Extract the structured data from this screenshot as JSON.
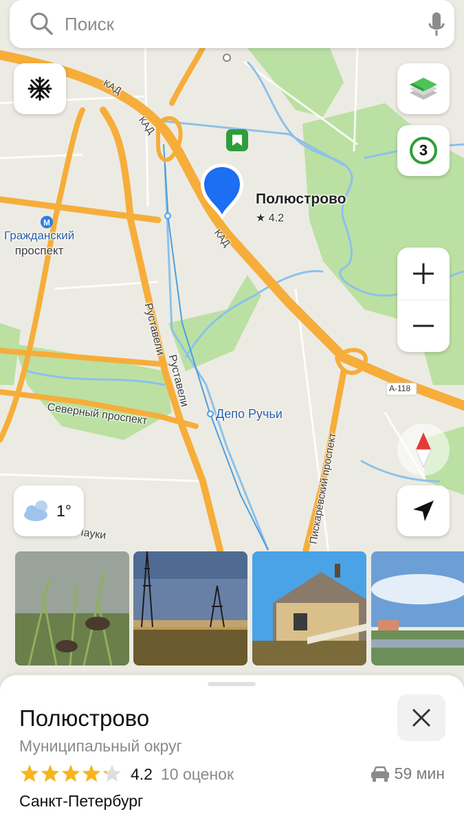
{
  "search": {
    "placeholder": "Поиск"
  },
  "map": {
    "roads": {
      "kad": "КАД",
      "rustaveli": "Руставели",
      "severny": "Северный проспект",
      "piskarevsky": "Пискарёвский проспект",
      "nauki": "Науки",
      "route_shield": "А-118"
    },
    "metro": {
      "name_line1": "Гражданский",
      "name_line2": "проспект",
      "color": "#2a7de1"
    },
    "station": "Депо Ручьи",
    "poi": {
      "name": "Полюстрово",
      "rating": "★ 4.2"
    },
    "colors": {
      "land": "#ecebe3",
      "park": "#a9d991",
      "water": "#8cc1ea",
      "major_road": "#f6ad3a",
      "pin": "#1c6ef2"
    }
  },
  "controls": {
    "traffic_level": "3",
    "traffic_color": "#2f9d3b",
    "weather_temp": "1°",
    "zoom_in": "+",
    "zoom_out": "−"
  },
  "photos": [
    {
      "alt": "birds in reeds"
    },
    {
      "alt": "power line at dusk"
    },
    {
      "alt": "old wooden house"
    },
    {
      "alt": "city panorama"
    }
  ],
  "card": {
    "title": "Полюстрово",
    "subtitle": "Муниципальный округ",
    "rating_value": "4.2",
    "rating_stars": 4.2,
    "reviews": "10 оценок",
    "city": "Санкт-Петербург",
    "route_time": "59 мин",
    "star_color": "#f7b41b"
  }
}
